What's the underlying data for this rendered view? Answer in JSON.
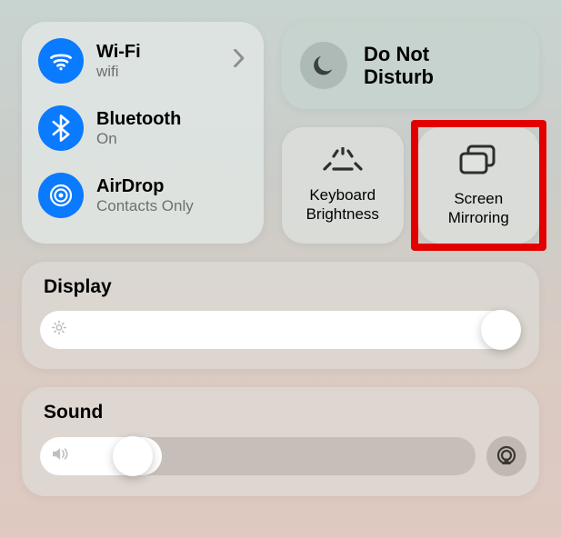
{
  "connectivity": {
    "wifi": {
      "title": "Wi-Fi",
      "status": "wifi"
    },
    "bluetooth": {
      "title": "Bluetooth",
      "status": "On"
    },
    "airdrop": {
      "title": "AirDrop",
      "status": "Contacts Only"
    }
  },
  "dnd": {
    "title": "Do Not\nDisturb"
  },
  "tiles": {
    "keyboard_brightness": "Keyboard\nBrightness",
    "screen_mirroring": "Screen\nMirroring"
  },
  "display": {
    "title": "Display",
    "value_pct": 100
  },
  "sound": {
    "title": "Sound",
    "value_pct": 18
  },
  "colors": {
    "accent": "#0a7aff",
    "highlight": "#e30000"
  }
}
